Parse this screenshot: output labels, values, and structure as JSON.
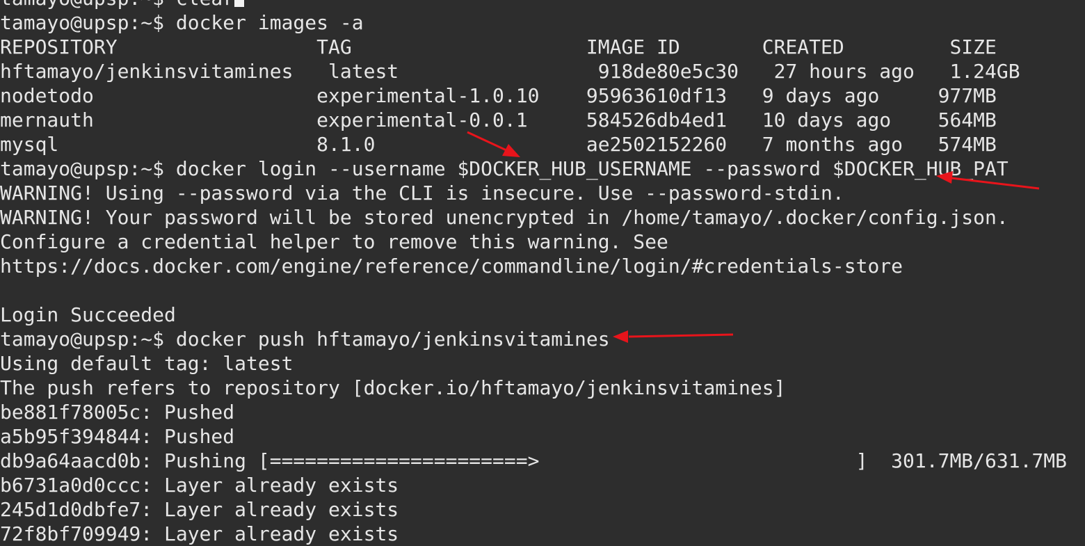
{
  "terminal": {
    "prompt": "tamayo@upsp:~$",
    "lines": [
      "tamayo@upsp:~$ clear",
      "tamayo@upsp:~$ docker images -a",
      "REPOSITORY                 TAG                    IMAGE ID       CREATED         SIZE",
      "hftamayo/jenkinsvitamines   latest                 918de80e5c30   27 hours ago   1.24GB",
      "nodetodo                   experimental-1.0.10    95963610df13   9 days ago     977MB",
      "mernauth                   experimental-0.0.1     584526db4ed1   10 days ago    564MB",
      "mysql                      8.1.0                  ae2502152260   7 months ago   574MB",
      "tamayo@upsp:~$ docker login --username $DOCKER_HUB_USERNAME --password $DOCKER_HUB_PAT",
      "WARNING! Using --password via the CLI is insecure. Use --password-stdin.",
      "WARNING! Your password will be stored unencrypted in /home/tamayo/.docker/config.json.",
      "Configure a credential helper to remove this warning. See",
      "https://docs.docker.com/engine/reference/commandline/login/#credentials-store",
      "",
      "Login Succeeded",
      "tamayo@upsp:~$ docker push hftamayo/jenkinsvitamines",
      "Using default tag: latest",
      "The push refers to repository [docker.io/hftamayo/jenkinsvitamines]",
      "be881f78005c: Pushed",
      "a5b95f394844: Pushed",
      "db9a64aacd0b: Pushing [======================>                           ]  301.7MB/631.7MB",
      "b6731a0d0ccc: Layer already exists",
      "245d1d0dbfe7: Layer already exists",
      "72f8bf709949: Layer already exists"
    ]
  },
  "colors": {
    "background": "#2d2d2d",
    "text": "#e6e6e6",
    "annotation_arrow": "#e8141b"
  }
}
